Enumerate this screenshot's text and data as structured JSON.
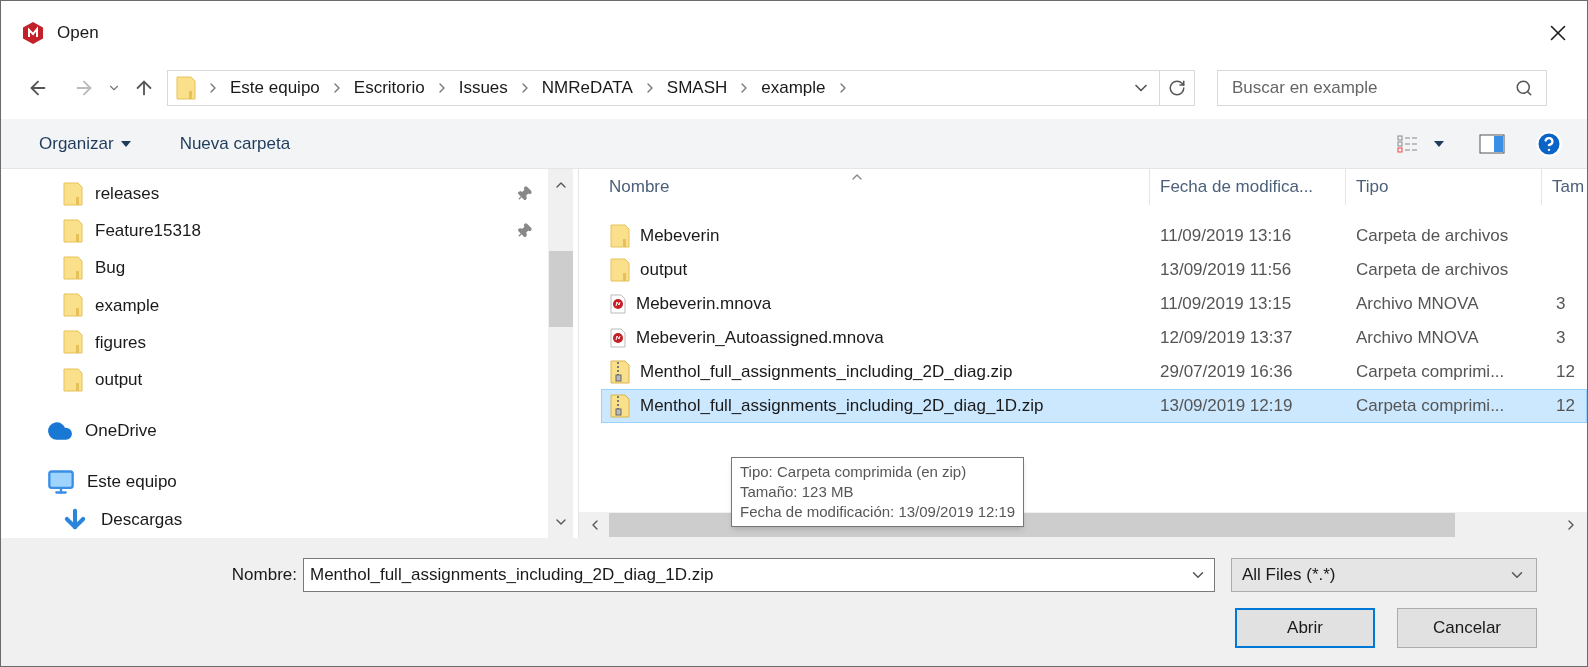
{
  "window": {
    "title": "Open"
  },
  "breadcrumb": [
    "Este equipo",
    "Escritorio",
    "Issues",
    "NMReDATA",
    "SMASH",
    "example"
  ],
  "search": {
    "placeholder": "Buscar en example"
  },
  "toolbar": [
    "Organizar",
    "Nueva carpeta"
  ],
  "sidebar": {
    "items": [
      {
        "label": "releases",
        "kind": "folder",
        "pinned": true
      },
      {
        "label": "Feature15318",
        "kind": "folder",
        "pinned": true
      },
      {
        "label": "Bug",
        "kind": "folder",
        "pinned": false
      },
      {
        "label": "example",
        "kind": "folder",
        "pinned": false
      },
      {
        "label": "figures",
        "kind": "folder",
        "pinned": false
      },
      {
        "label": "output",
        "kind": "folder",
        "pinned": false
      },
      {
        "label": "OneDrive",
        "kind": "cloud",
        "pinned": false
      },
      {
        "label": "Este equipo",
        "kind": "pc",
        "pinned": false
      },
      {
        "label": "Descargas",
        "kind": "download",
        "pinned": false
      }
    ]
  },
  "table": {
    "columns": [
      "Nombre",
      "Fecha de modifica...",
      "Tipo",
      "Tam"
    ],
    "rows": [
      {
        "kind": "folder",
        "selected": false,
        "cells": [
          "Mebeverin",
          "11/09/2019 13:16",
          "Carpeta de archivos",
          ""
        ]
      },
      {
        "kind": "folder",
        "selected": false,
        "cells": [
          "output",
          "13/09/2019 11:56",
          "Carpeta de archivos",
          ""
        ]
      },
      {
        "kind": "mnova",
        "selected": false,
        "cells": [
          "Mebeverin.mnova",
          "11/09/2019 13:15",
          "Archivo MNOVA",
          "3"
        ]
      },
      {
        "kind": "mnova",
        "selected": false,
        "cells": [
          "Mebeverin_Autoassigned.mnova",
          "12/09/2019 13:37",
          "Archivo MNOVA",
          "3"
        ]
      },
      {
        "kind": "zip",
        "selected": false,
        "cells": [
          "Menthol_full_assignments_including_2D_diag.zip",
          "29/07/2019 16:36",
          "Carpeta comprimi...",
          "12"
        ]
      },
      {
        "kind": "zip",
        "selected": true,
        "cells": [
          "Menthol_full_assignments_including_2D_diag_1D.zip",
          "13/09/2019 12:19",
          "Carpeta comprimi...",
          "12"
        ]
      }
    ]
  },
  "tooltip": [
    "Tipo: Carpeta comprimida (en zip)",
    "Tamaño: 123 MB",
    "Fecha de modificación: 13/09/2019 12:19"
  ],
  "filename": {
    "label": "Nombre:",
    "value": "Menthol_full_assignments_including_2D_diag_1D.zip"
  },
  "filetype": {
    "value": "All Files (*.*)"
  },
  "buttons": [
    "Abrir",
    "Cancelar"
  ]
}
